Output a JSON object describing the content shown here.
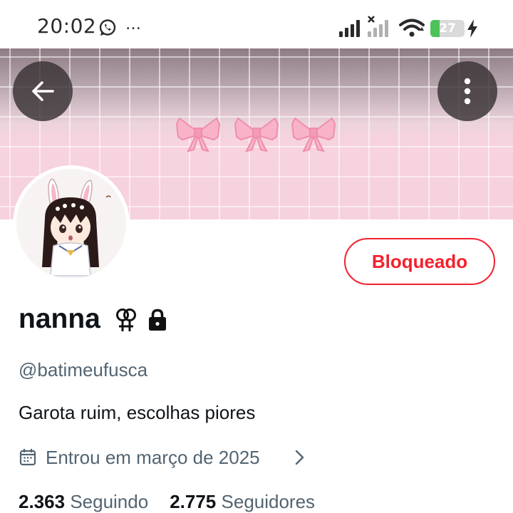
{
  "status_bar": {
    "time": "20:02",
    "more": "…",
    "battery_level": "27",
    "battery_fraction": 0.27,
    "icons": [
      "whatsapp-icon",
      "signal-icon",
      "signal-x-icon",
      "wifi-icon",
      "battery-icon",
      "charging-bolt-icon"
    ]
  },
  "header": {
    "back_icon": "arrow-left-icon",
    "menu_icon": "vertical-dots-icon"
  },
  "banner": {
    "theme": "pink-grid-with-pixel-bows",
    "bow_count": 3
  },
  "profile": {
    "display_name": "nanna",
    "name_emoji": "⚢",
    "handle": "@batimeufusca",
    "bio": "Garota ruim, escolhas piores",
    "joined": "Entrou em março de 2025",
    "protected": true,
    "relationship_button": "Bloqueado"
  },
  "stats": {
    "following_count": "2.363",
    "following_label": "Seguindo",
    "followers_count": "2.775",
    "followers_label": "Seguidores"
  },
  "colors": {
    "accent_red": "#f4212e",
    "text_primary": "#0f1419",
    "text_secondary": "#536471",
    "banner_pink": "#f6d2de",
    "battery_green": "#4cc35a"
  }
}
